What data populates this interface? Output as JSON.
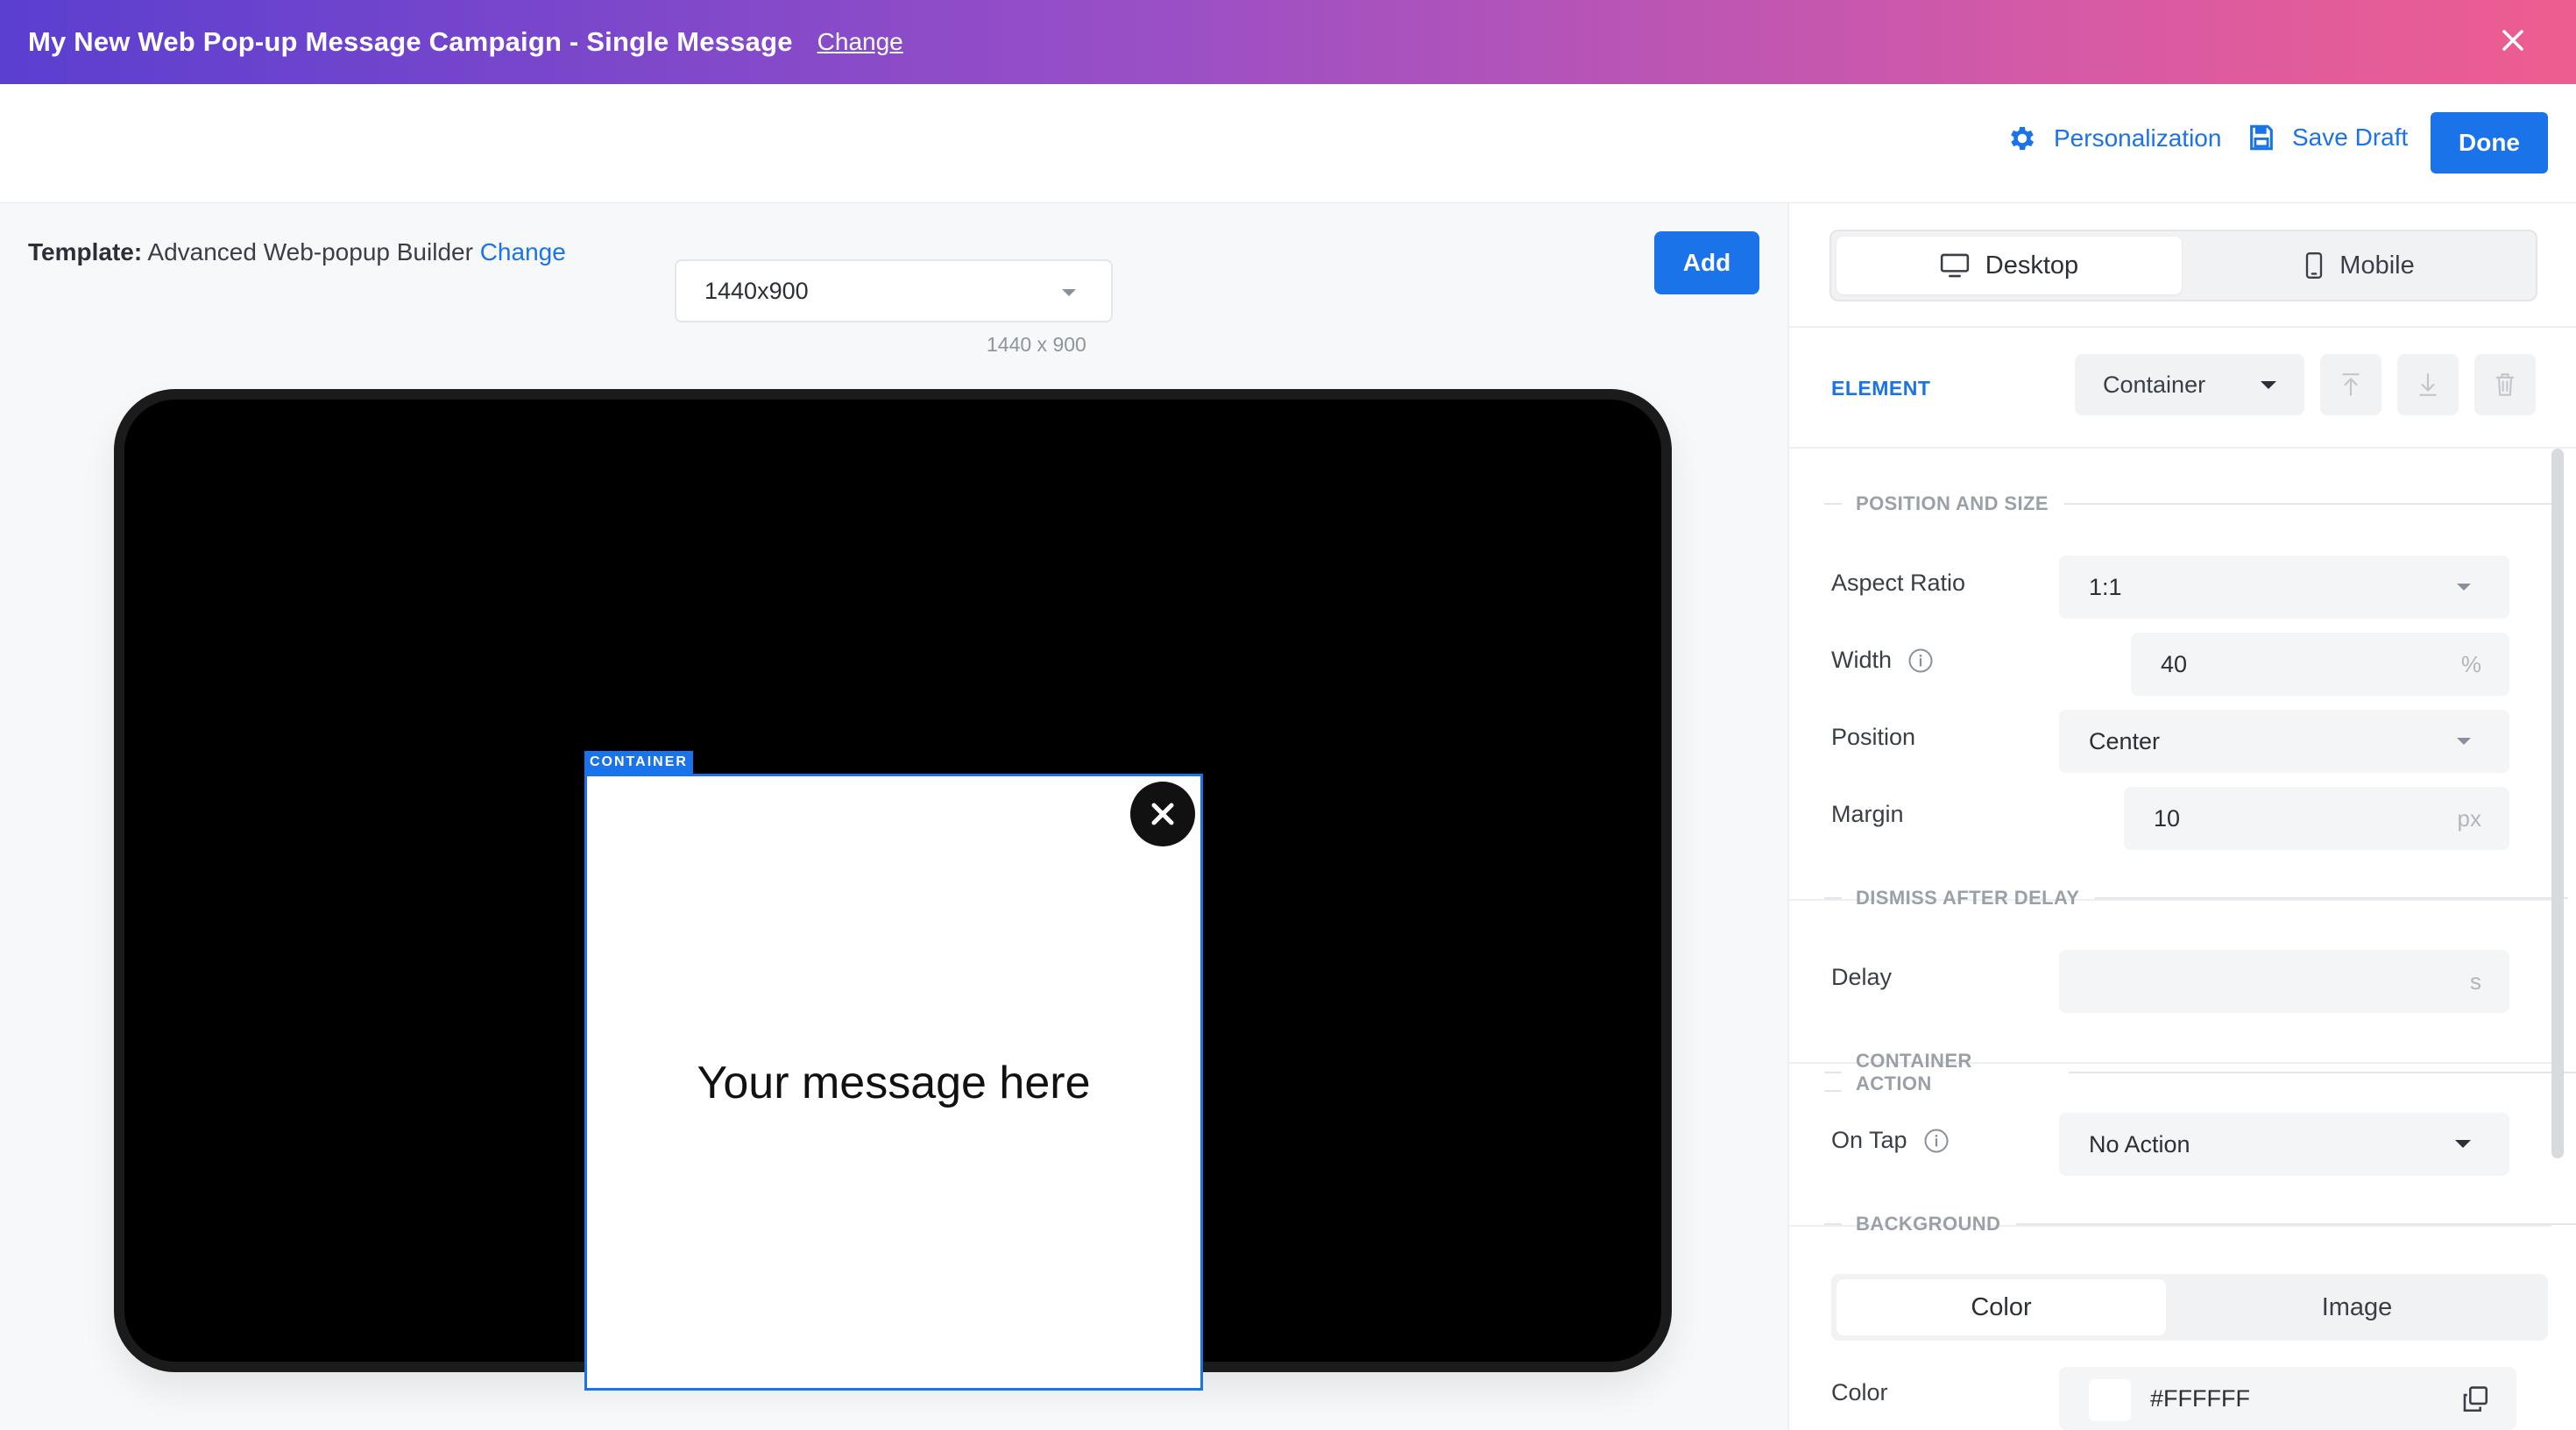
{
  "titlebar": {
    "title": "My New Web Pop-up Message Campaign - Single Message",
    "change_label": "Change"
  },
  "toolbar": {
    "personalization_label": "Personalization",
    "save_draft_label": "Save Draft",
    "done_label": "Done"
  },
  "canvas": {
    "template_label": "Template:",
    "template_name": "Advanced Web-popup Builder",
    "template_change": "Change",
    "resolution_value": "1440x900",
    "resolution_sub": "1440 x 900",
    "add_label": "Add",
    "container_tag": "CONTAINER",
    "message_text": "Your message here"
  },
  "panel": {
    "tabs": [
      {
        "label": "Desktop",
        "active": true
      },
      {
        "label": "Mobile",
        "active": false
      }
    ],
    "element_label": "ELEMENT",
    "element_value": "Container",
    "sections": {
      "position_and_size": "POSITION AND SIZE",
      "dismiss_after_delay": "DISMISS AFTER DELAY",
      "container_action": "CONTAINER ACTION",
      "background": "BACKGROUND"
    },
    "fields": {
      "aspect_ratio": {
        "label": "Aspect Ratio",
        "value": "1:1"
      },
      "width": {
        "label": "Width",
        "value": "40",
        "unit": "%"
      },
      "position": {
        "label": "Position",
        "value": "Center"
      },
      "margin": {
        "label": "Margin",
        "value": "10",
        "unit": "px"
      },
      "delay": {
        "label": "Delay",
        "value": "",
        "unit": "s"
      },
      "on_tap": {
        "label": "On Tap",
        "value": "No Action"
      },
      "color": {
        "label": "Color",
        "value": "#FFFFFF"
      }
    },
    "background_tabs": [
      {
        "label": "Color",
        "active": true
      },
      {
        "label": "Image",
        "active": false
      }
    ]
  },
  "colors": {
    "accent": "#1a73e8",
    "gradient_start": "#5b3fd0",
    "gradient_end": "#ee5d8f",
    "swatch": "#FFFFFF"
  }
}
